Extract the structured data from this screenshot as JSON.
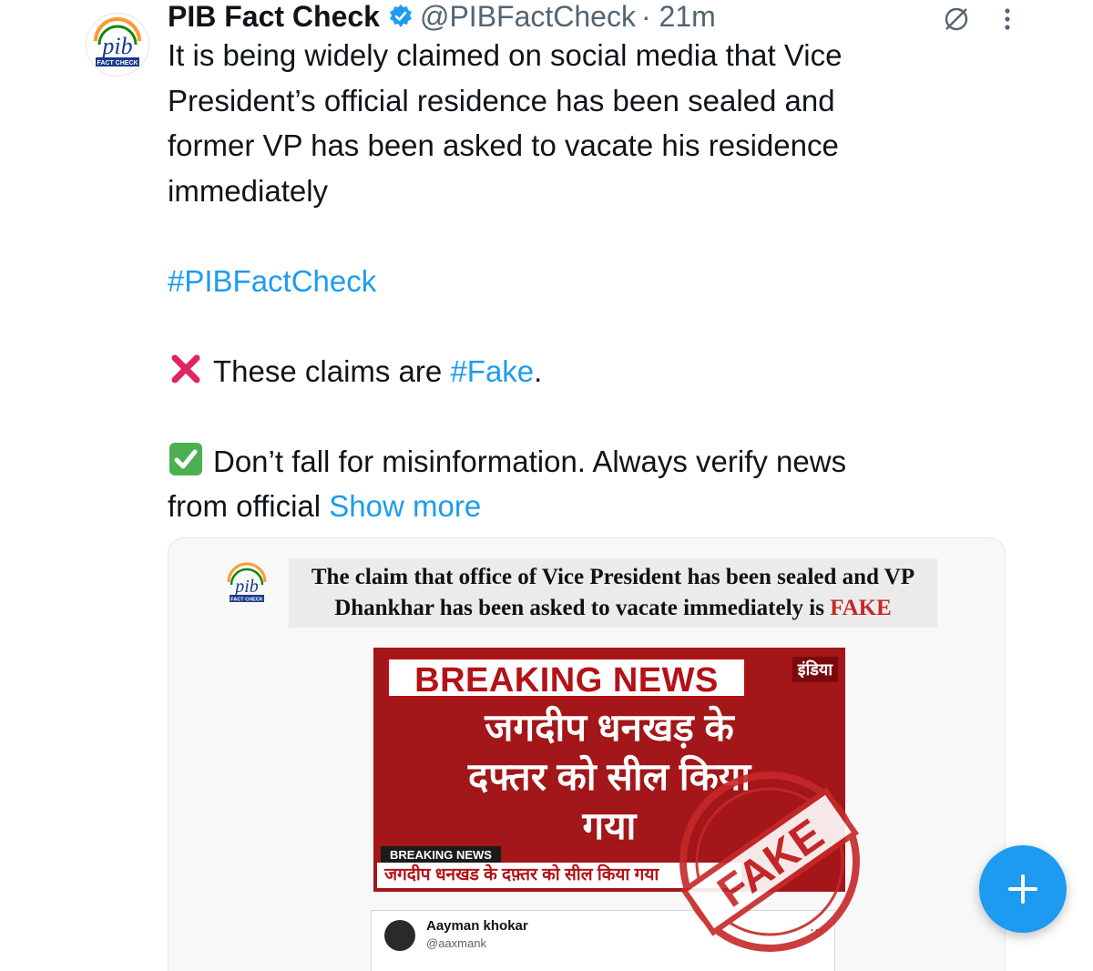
{
  "tweet": {
    "author_name": "PIB Fact Check",
    "handle": "@PIBFactCheck",
    "time": "· 21m",
    "lines": [
      "It is being widely claimed on social media that Vice",
      "President’s official residence has been sealed and",
      "former VP has been asked to vacate his residence",
      "immediately"
    ],
    "hashtag": "#PIBFactCheck",
    "claims_prefix": "These claims are ",
    "claims_tag": "#Fake",
    "claims_suffix": ".",
    "verify_line1": "Don’t fall for misinformation. Always verify news",
    "verify_line2": "from official",
    "show_more": "Show more"
  },
  "card": {
    "headline_line1": "The claim that office of Vice President has been sealed and VP",
    "headline_line2_prefix": "Dhankhar has been asked to vacate immediately is ",
    "headline_fake": "FAKE",
    "logo_text": "pib",
    "logo_sub": "FACT CHECK",
    "news": {
      "breaking": "BREAKING NEWS",
      "channel": "इंडिया",
      "hindi_line1": "जगदीप धनखड़ के",
      "hindi_line2": "दफ्तर को सील किया",
      "hindi_line3": "गया",
      "ticker_label": "BREAKING NEWS",
      "ticker_text": "जगदीप धनखड के दफ़्तर को सील किया गया"
    },
    "embedded_tweet": {
      "name": "Aayman khokar",
      "handle": "@aaxmank",
      "more": "..."
    },
    "stamp_text": "FAKE"
  },
  "colors": {
    "link": "#1d9bf0",
    "fake_red": "#c62828",
    "news_red": "#a3161a"
  },
  "icons": [
    "verified-badge-icon",
    "grok-icon",
    "more-icon",
    "cross-mark-icon",
    "check-mark-icon",
    "compose-plus-icon"
  ]
}
